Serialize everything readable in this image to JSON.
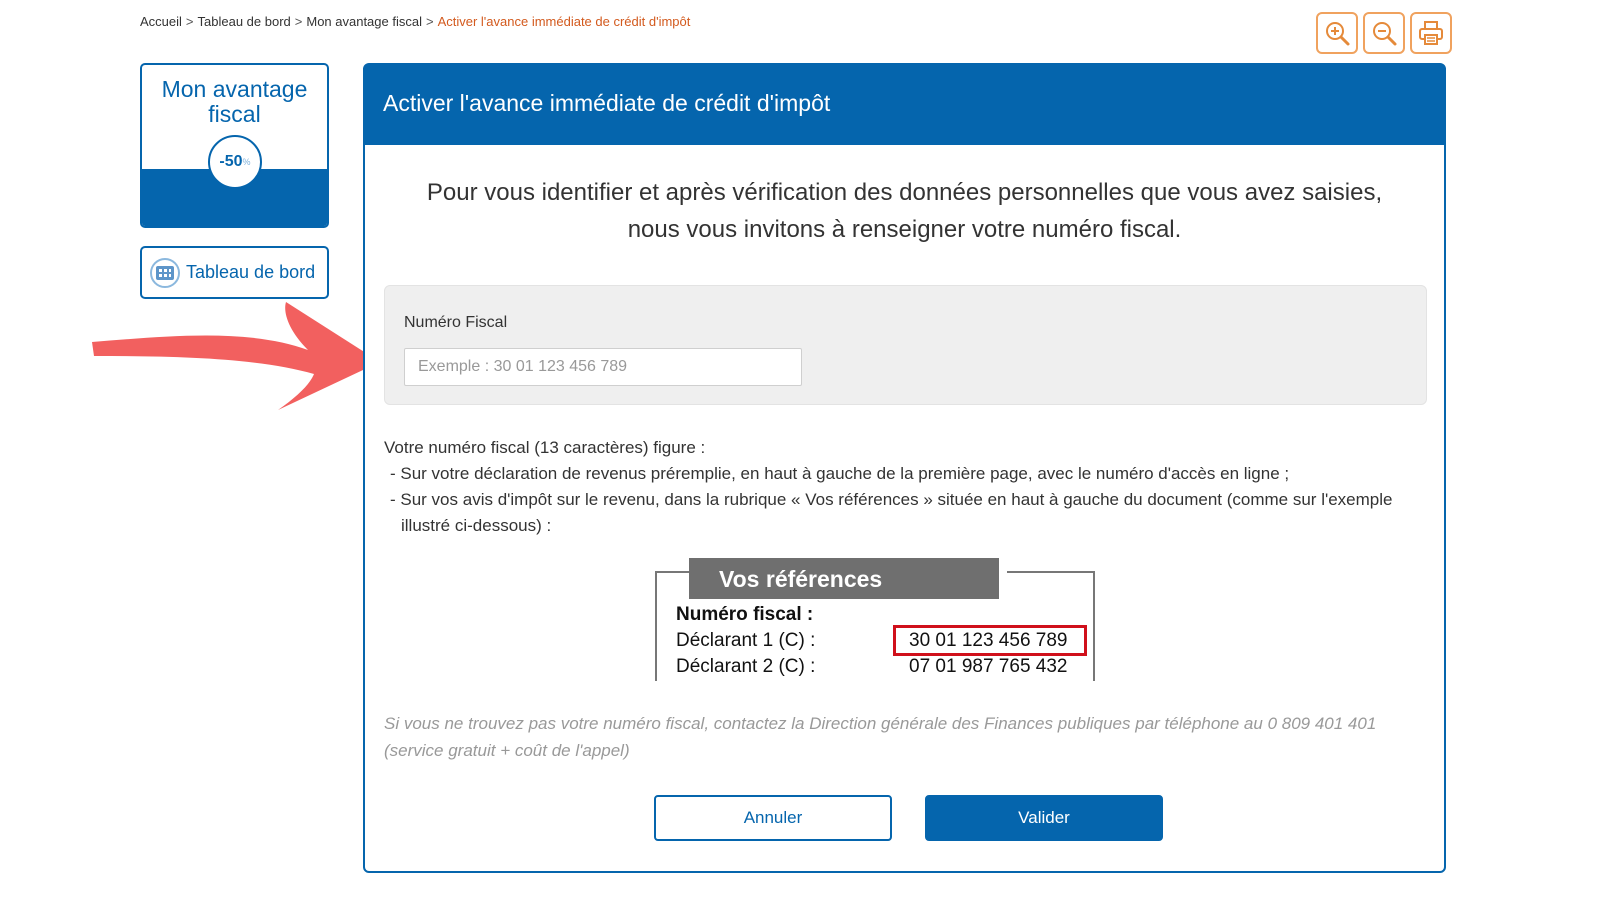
{
  "breadcrumb": {
    "items": [
      "Accueil",
      "Tableau de bord",
      "Mon avantage fiscal"
    ],
    "separator": ">",
    "current": "Activer l'avance immédiate de crédit d'impôt"
  },
  "toolbar": {
    "zoom_in_icon": "zoom-in-icon",
    "zoom_out_icon": "zoom-out-icon",
    "print_icon": "printer-icon"
  },
  "sidebar": {
    "card_title": "Mon avantage fiscal",
    "badge": "-50",
    "badge_sup": "%",
    "dashboard_label": "Tableau de bord"
  },
  "panel": {
    "title": "Activer l'avance immédiate de crédit d'impôt",
    "intro_line1": "Pour vous identifier et après vérification des données personnelles que vous avez saisies,",
    "intro_line2": "nous vous invitons à renseigner votre numéro fiscal.",
    "field_label": "Numéro Fiscal",
    "field_placeholder": "Exemple : 30 01 123 456 789",
    "field_value": "",
    "info_heading": "Votre numéro fiscal (13 caractères) figure :",
    "info_line1": "- Sur votre déclaration de revenus préremplie, en haut à  gauche de la première page, avec le numéro d'accès en ligne ;",
    "info_line2": "- Sur vos avis d'impôt sur le revenu, dans la rubrique « Vos références » située en haut à  gauche du document (comme sur l'exemple illustré ci-dessous) :",
    "reference": {
      "title": "Vos références",
      "label_numero": "Numéro fiscal :",
      "label_declarant1": "Déclarant 1 (C) :",
      "value_declarant1": "30 01 123 456 789",
      "label_declarant2": "Déclarant 2 (C) :",
      "value_declarant2": "07 01 987 765 432"
    },
    "help_note": "Si vous ne trouvez pas votre numéro fiscal, contactez la Direction générale des Finances publiques par téléphone au 0 809 401 401 (service gratuit + coût de l'appel)",
    "cancel_label": "Annuler",
    "submit_label": "Valider"
  },
  "colors": {
    "brand_blue": "#0565ad",
    "accent_orange": "#f0a25e",
    "highlight_red": "#d0101b",
    "annotation_arrow": "#f2605f"
  }
}
